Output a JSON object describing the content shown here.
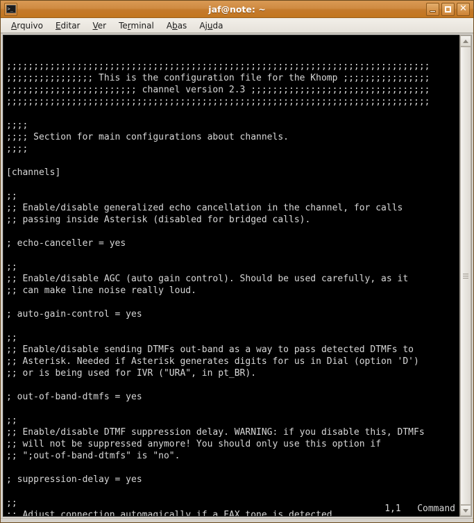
{
  "window": {
    "title": "jaf@note: ~",
    "icon": "terminal-icon",
    "buttons": [
      {
        "name": "minimize-button",
        "label": "–"
      },
      {
        "name": "maximize-button",
        "label": "□"
      },
      {
        "name": "close-button",
        "label": "✕"
      }
    ],
    "colors": {
      "titlebar_top": "#d99a54",
      "titlebar_bottom": "#c2761f",
      "frame": "#d6d2cb",
      "terminal_bg": "#000000",
      "terminal_fg": "#d8d8d8"
    }
  },
  "menubar": {
    "items": [
      {
        "name": "menu-arquivo",
        "pre": "",
        "mnemonic": "A",
        "post": "rquivo"
      },
      {
        "name": "menu-editar",
        "pre": "",
        "mnemonic": "E",
        "post": "ditar"
      },
      {
        "name": "menu-ver",
        "pre": "",
        "mnemonic": "V",
        "post": "er"
      },
      {
        "name": "menu-terminal",
        "pre": "Te",
        "mnemonic": "r",
        "post": "minal"
      },
      {
        "name": "menu-abas",
        "pre": "A",
        "mnemonic": "b",
        "post": "as"
      },
      {
        "name": "menu-ajuda",
        "pre": "Aj",
        "mnemonic": "u",
        "post": "da"
      }
    ]
  },
  "terminal": {
    "lines": [
      ";;;;;;;;;;;;;;;;;;;;;;;;;;;;;;;;;;;;;;;;;;;;;;;;;;;;;;;;;;;;;;;;;;;;;;;;;;;;;;",
      ";;;;;;;;;;;;;;;; This is the configuration file for the Khomp ;;;;;;;;;;;;;;;;",
      ";;;;;;;;;;;;;;;;;;;;;;;; channel version 2.3 ;;;;;;;;;;;;;;;;;;;;;;;;;;;;;;;;;",
      ";;;;;;;;;;;;;;;;;;;;;;;;;;;;;;;;;;;;;;;;;;;;;;;;;;;;;;;;;;;;;;;;;;;;;;;;;;;;;;",
      "",
      ";;;;",
      ";;;; Section for main configurations about channels.",
      ";;;;",
      "",
      "[channels]",
      "",
      ";;",
      ";; Enable/disable generalized echo cancellation in the channel, for calls",
      ";; passing inside Asterisk (disabled for bridged calls).",
      "",
      "; echo-canceller = yes",
      "",
      ";;",
      ";; Enable/disable AGC (auto gain control). Should be used carefully, as it",
      ";; can make line noise really loud.",
      "",
      "; auto-gain-control = yes",
      "",
      ";;",
      ";; Enable/disable sending DTMFs out-band as a way to pass detected DTMFs to",
      ";; Asterisk. Needed if Asterisk generates digits for us in Dial (option 'D')",
      ";; or is being used for IVR (\"URA\", in pt_BR).",
      "",
      "; out-of-band-dtmfs = yes",
      "",
      ";;",
      ";; Enable/disable DTMF suppression delay. WARNING: if you disable this, DTMFs",
      ";; will not be suppressed anymore! You should only use this option if",
      ";; \";out-of-band-dtmfs\" is \"no\".",
      "",
      "; suppression-delay = yes",
      "",
      ";;",
      ";; Adjust connection automagically if a FAX tone is detected."
    ],
    "status": {
      "position": "1,1",
      "mode": "Command"
    }
  },
  "scrollbar": {
    "up_arrow": "scroll-up-arrow-icon",
    "down_arrow": "scroll-down-arrow-icon",
    "thumb": "scrollbar-thumb"
  }
}
